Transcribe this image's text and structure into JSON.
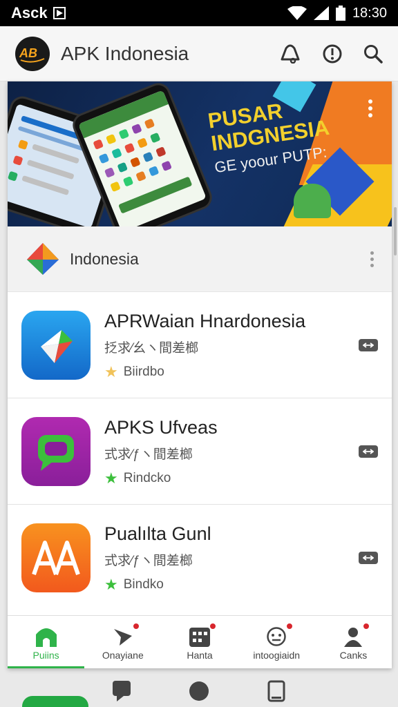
{
  "status_bar": {
    "carrier": "Asck",
    "time": "18:30",
    "icons": [
      "play-store-icon",
      "wifi-icon",
      "signal-icon",
      "battery-icon"
    ]
  },
  "app_bar": {
    "title": "APK Indonesia",
    "logo_icon": "apk-logo-icon",
    "actions": [
      "notification-bell-icon",
      "info-icon",
      "search-icon"
    ]
  },
  "banner": {
    "line1": "PUSAR",
    "line2": "INDGNESIA",
    "line3": "GE yoour PUTP:"
  },
  "section": {
    "title": "Indonesia",
    "icon": "gem-logo-icon"
  },
  "apps": [
    {
      "name": "APRWaian Hnardonesia",
      "subtitle": "抸求⁄幺ヽ間差榔",
      "rating_label": "Biirdbo",
      "star_color": "#f1c35a",
      "icon": "blue-arrow-app-icon"
    },
    {
      "name": "APKS Ufveas",
      "subtitle": "式求⁄ƒヽ間差榔",
      "rating_label": "Rindcko",
      "star_color": "#3cbf3c",
      "icon": "purple-chat-app-icon"
    },
    {
      "name": "Pualılta Gunl",
      "subtitle": "式求⁄ƒヽ間差榔",
      "rating_label": "Bindko",
      "star_color": "#3cbf3c",
      "icon": "orange-aa-app-icon"
    }
  ],
  "bottom_nav": [
    {
      "label": "Puiins",
      "icon": "home-icon",
      "active": true,
      "badge": false
    },
    {
      "label": "Onayiane",
      "icon": "send-icon",
      "active": false,
      "badge": true
    },
    {
      "label": "Hanta",
      "icon": "grid-icon",
      "active": false,
      "badge": true
    },
    {
      "label": "intoogiaidn",
      "icon": "face-icon",
      "active": false,
      "badge": true
    },
    {
      "label": "Canks",
      "icon": "person-icon",
      "active": false,
      "badge": true
    }
  ],
  "system_nav": [
    "back-icon",
    "home-circle-icon",
    "recents-icon"
  ],
  "colors": {
    "accent_green": "#2fb34a",
    "banner_yellow": "#f3d02d",
    "badge_red": "#d8262d"
  }
}
